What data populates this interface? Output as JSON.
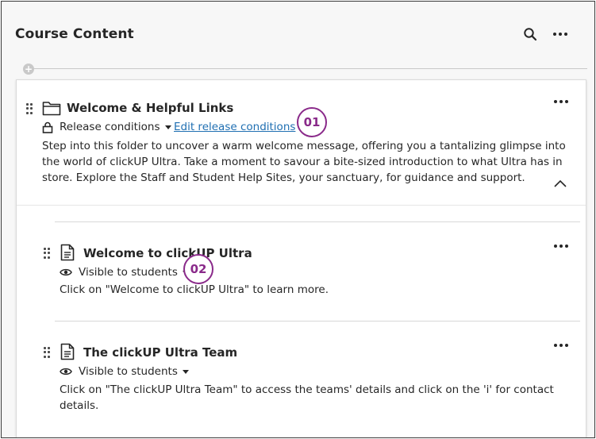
{
  "header": {
    "title": "Course Content",
    "search_icon": "search-icon",
    "more_icon": "more-options-icon"
  },
  "add_button": "+",
  "folder": {
    "title": "Welcome & Helpful Links",
    "icon": "folder-icon",
    "release_label": "Release conditions",
    "edit_release_link": "Edit release conditions",
    "description_lines": [
      "Step into this folder to uncover a warm welcome message, offering you a tantalizing glimpse into",
      "the world of clickUP Ultra. Take a moment to savour a bite-sized introduction to what Ultra has in",
      "store. Explore the Staff and Student Help Sites, your sanctuary, for guidance and support."
    ],
    "expanded": true
  },
  "items": [
    {
      "title": "Welcome to clickUP Ultra",
      "icon": "document-icon",
      "visibility": "Visible to students",
      "description_lines": [
        "Click on \"Welcome to clickUP Ultra\" to learn more."
      ]
    },
    {
      "title": "The clickUP Ultra Team",
      "icon": "document-icon",
      "visibility": "Visible to students",
      "description_lines": [
        "Click on \"The clickUP Ultra Team\" to access the teams' details and click on the 'i' for contact",
        "details."
      ]
    }
  ],
  "callouts": [
    "01",
    "02"
  ],
  "colors": {
    "accent_link": "#1f6fb2",
    "callout": "#8a2a8a",
    "background": "#f7f7f7"
  }
}
